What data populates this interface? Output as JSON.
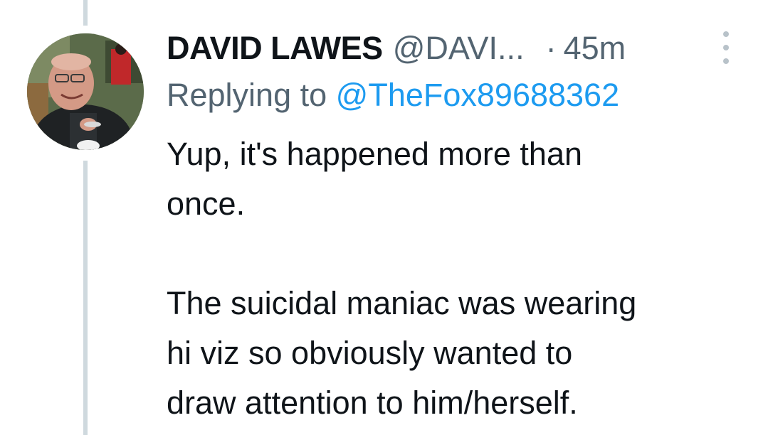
{
  "tweet": {
    "author_name": "DAVID LAWES",
    "author_handle": "@DAVI...",
    "separator": "·",
    "time": "45m",
    "replying_prefix": "Replying to",
    "replying_to": "@TheFox89688362",
    "text_lines": [
      "Yup, it's happened more than",
      "once.",
      "",
      "The suicidal maniac was wearing",
      "hi viz so obviously wanted to",
      "draw attention to him/herself."
    ]
  },
  "icons": {
    "more": "more-vertical-icon",
    "avatar": "profile-photo"
  },
  "colors": {
    "text": "#0f1419",
    "secondary": "#536471",
    "link": "#1d9bf0",
    "thread_line": "#cfd9de"
  }
}
